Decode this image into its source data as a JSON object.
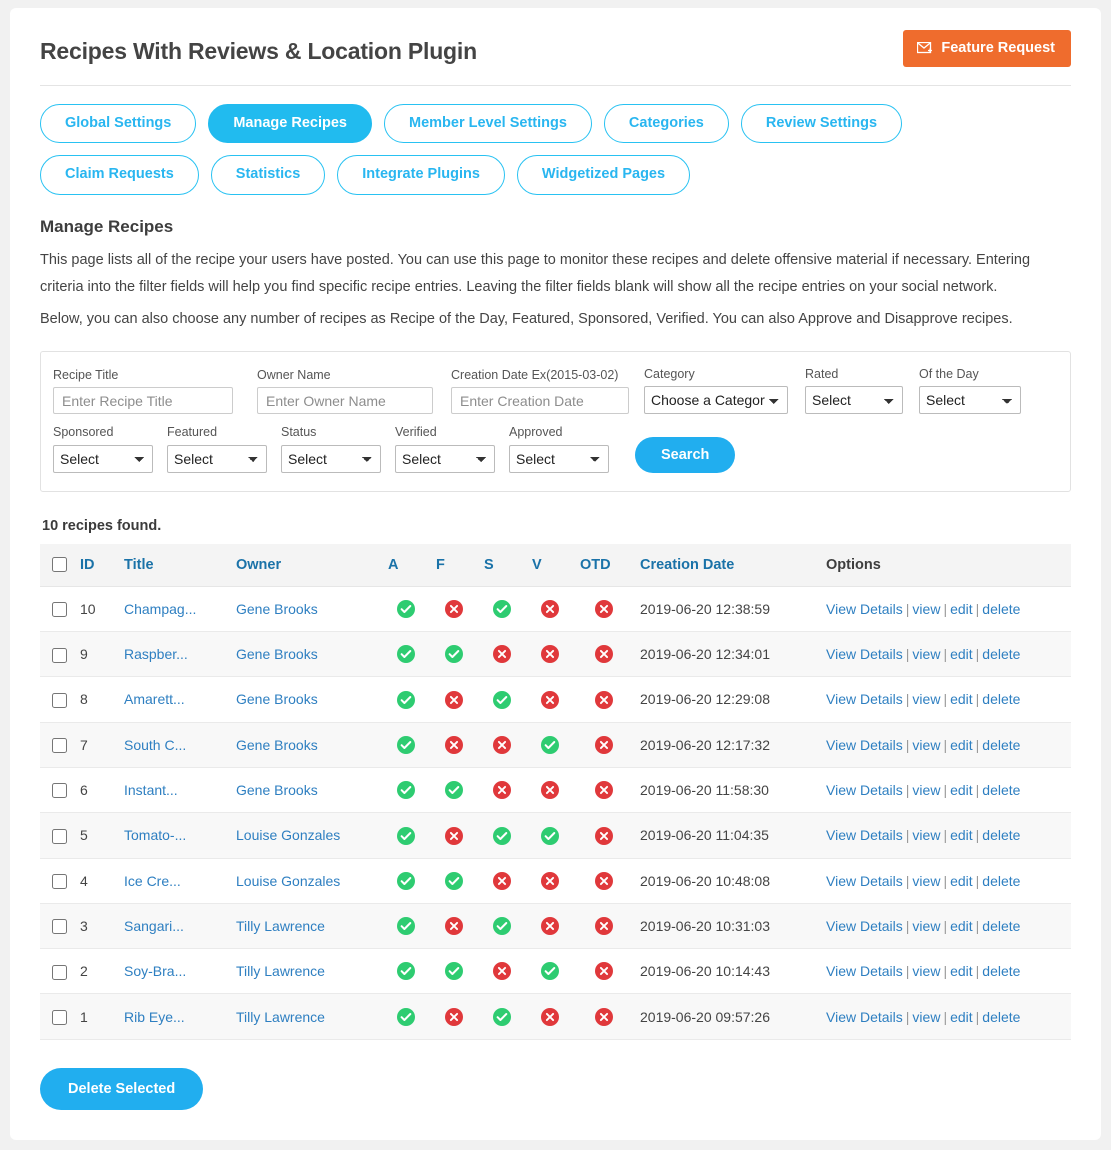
{
  "header": {
    "title": "Recipes With Reviews & Location Plugin",
    "feature_request_label": "Feature Request",
    "feature_request_color": "#ef6c2d"
  },
  "tabs": [
    {
      "label": "Global Settings",
      "active": false
    },
    {
      "label": "Manage Recipes",
      "active": true
    },
    {
      "label": "Member Level Settings",
      "active": false
    },
    {
      "label": "Categories",
      "active": false
    },
    {
      "label": "Review Settings",
      "active": false
    },
    {
      "label": "Claim Requests",
      "active": false
    },
    {
      "label": "Statistics",
      "active": false
    },
    {
      "label": "Integrate Plugins",
      "active": false
    },
    {
      "label": "Widgetized Pages",
      "active": false
    }
  ],
  "accent_color": "#21bbef",
  "intro": {
    "heading": "Manage Recipes",
    "paragraph1": "This page lists all of the recipe your users have posted. You can use this page to monitor these recipes and delete offensive material if necessary. Entering criteria into the filter fields will help you find specific recipe entries. Leaving the filter fields blank will show all the recipe entries on your social network.",
    "paragraph2": "Below, you can also choose any number of recipes as Recipe of the Day, Featured, Sponsored, Verified. You can also Approve and Disapprove recipes."
  },
  "filters": {
    "recipe_title": {
      "label": "Recipe Title",
      "placeholder": "Enter Recipe Title",
      "value": ""
    },
    "owner_name": {
      "label": "Owner Name",
      "placeholder": "Enter Owner Name",
      "value": ""
    },
    "creation_date": {
      "label": "Creation Date Ex(2015-03-02)",
      "placeholder": "Enter Creation Date",
      "value": ""
    },
    "category": {
      "label": "Category",
      "selected": "Choose a Category"
    },
    "rated": {
      "label": "Rated",
      "selected": "Select"
    },
    "of_the_day": {
      "label": "Of the Day",
      "selected": "Select"
    },
    "sponsored": {
      "label": "Sponsored",
      "selected": "Select"
    },
    "featured": {
      "label": "Featured",
      "selected": "Select"
    },
    "status": {
      "label": "Status",
      "selected": "Select"
    },
    "verified": {
      "label": "Verified",
      "selected": "Select"
    },
    "approved": {
      "label": "Approved",
      "selected": "Select"
    },
    "search_label": "Search"
  },
  "results": {
    "found_text": "10 recipes found.",
    "columns": {
      "id": "ID",
      "title": "Title",
      "owner": "Owner",
      "a": "A",
      "f": "F",
      "s": "S",
      "v": "V",
      "otd": "OTD",
      "creation_date": "Creation Date",
      "options": "Options"
    },
    "option_labels": {
      "view_details": "View Details",
      "view": "view",
      "edit": "edit",
      "delete": "delete"
    },
    "rows": [
      {
        "id": "10",
        "title": "Champag...",
        "owner": "Gene Brooks",
        "a": true,
        "f": false,
        "s": true,
        "v": false,
        "otd": false,
        "date": "2019-06-20 12:38:59"
      },
      {
        "id": "9",
        "title": "Raspber...",
        "owner": "Gene Brooks",
        "a": true,
        "f": true,
        "s": false,
        "v": false,
        "otd": false,
        "date": "2019-06-20 12:34:01"
      },
      {
        "id": "8",
        "title": "Amarett...",
        "owner": "Gene Brooks",
        "a": true,
        "f": false,
        "s": true,
        "v": false,
        "otd": false,
        "date": "2019-06-20 12:29:08"
      },
      {
        "id": "7",
        "title": "South C...",
        "owner": "Gene Brooks",
        "a": true,
        "f": false,
        "s": false,
        "v": true,
        "otd": false,
        "date": "2019-06-20 12:17:32"
      },
      {
        "id": "6",
        "title": "Instant...",
        "owner": "Gene Brooks",
        "a": true,
        "f": true,
        "s": false,
        "v": false,
        "otd": false,
        "date": "2019-06-20 11:58:30"
      },
      {
        "id": "5",
        "title": "Tomato-...",
        "owner": "Louise Gonzales",
        "a": true,
        "f": false,
        "s": true,
        "v": true,
        "otd": false,
        "date": "2019-06-20 11:04:35"
      },
      {
        "id": "4",
        "title": "Ice Cre...",
        "owner": "Louise Gonzales",
        "a": true,
        "f": true,
        "s": false,
        "v": false,
        "otd": false,
        "date": "2019-06-20 10:48:08"
      },
      {
        "id": "3",
        "title": "Sangari...",
        "owner": "Tilly Lawrence",
        "a": true,
        "f": false,
        "s": true,
        "v": false,
        "otd": false,
        "date": "2019-06-20 10:31:03"
      },
      {
        "id": "2",
        "title": "Soy-Bra...",
        "owner": "Tilly Lawrence",
        "a": true,
        "f": true,
        "s": false,
        "v": true,
        "otd": false,
        "date": "2019-06-20 10:14:43"
      },
      {
        "id": "1",
        "title": "Rib Eye...",
        "owner": "Tilly Lawrence",
        "a": true,
        "f": false,
        "s": true,
        "v": false,
        "otd": false,
        "date": "2019-06-20 09:57:26"
      }
    ],
    "yes_color": "#2ecc71",
    "no_color": "#e0383b"
  },
  "footer": {
    "delete_selected_label": "Delete Selected"
  }
}
